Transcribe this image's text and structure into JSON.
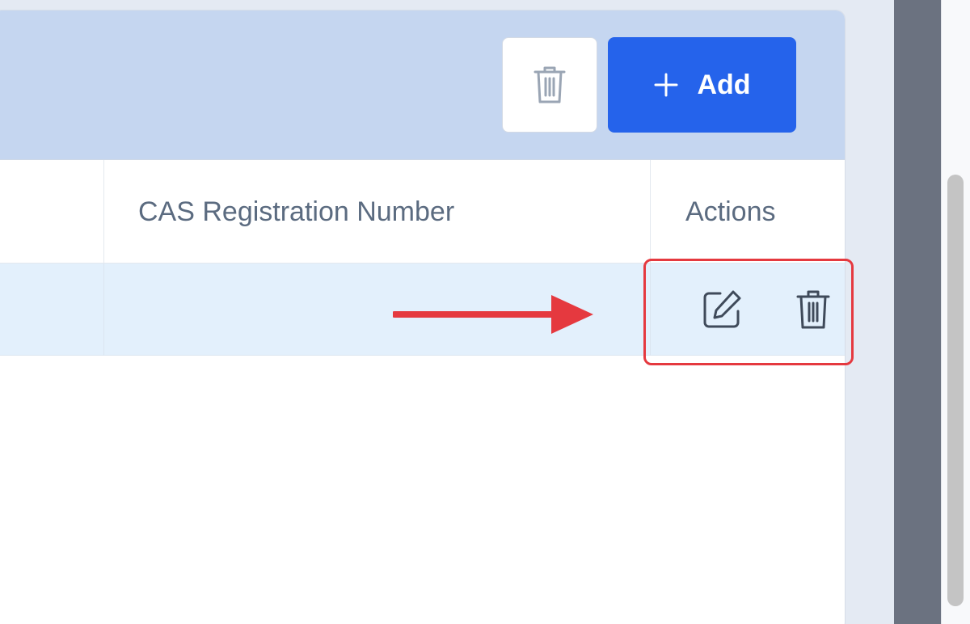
{
  "toolbar": {
    "add_label": "Add",
    "bulk_delete_icon": "trash-icon",
    "add_icon": "plus-icon"
  },
  "table": {
    "columns": [
      "CAS Registration Number",
      "Actions"
    ],
    "rows": [
      {
        "cas_registration_number": "",
        "actions": [
          "edit-icon",
          "trash-icon"
        ]
      }
    ]
  },
  "annotation": {
    "arrow_color": "#e5393f",
    "highlight_color": "#e5393f"
  },
  "colors": {
    "header_bg": "#c5d6f0",
    "primary": "#2563eb",
    "row_selected_bg": "#e3f0fc",
    "text_muted": "#5b6b80"
  }
}
